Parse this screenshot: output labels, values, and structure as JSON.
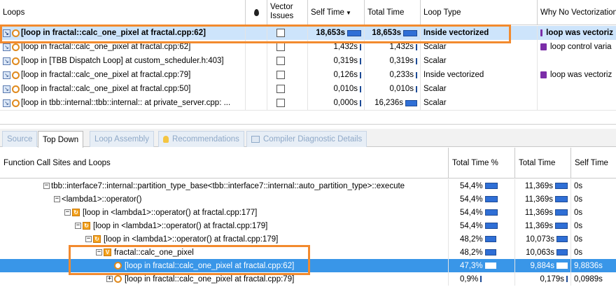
{
  "top_table": {
    "headers": {
      "loops": "Loops",
      "vector_issues": "Vector\nIssues",
      "self_time": "Self Time",
      "total_time": "Total Time",
      "loop_type": "Loop Type",
      "why_no_vec": "Why No Vectorization"
    },
    "rows": [
      {
        "name": "[loop in fractal::calc_one_pixel at fractal.cpp:62]",
        "self": "18,653s",
        "total": "18,653s",
        "type": "Inside vectorized",
        "why": "loop was vectoriz",
        "self_bar": 1.0,
        "total_bar": 1.0,
        "has_why": true
      },
      {
        "name": "[loop in fractal::calc_one_pixel at fractal.cpp:62]",
        "self": "1,432s",
        "total": "1,432s",
        "type": "Scalar",
        "why": "loop control varia",
        "self_bar": 0.08,
        "total_bar": 0.08,
        "has_why": true
      },
      {
        "name": "[loop in [TBB Dispatch Loop] at custom_scheduler.h:403]",
        "self": "0,319s",
        "total": "0,319s",
        "type": "Scalar",
        "why": "",
        "self_bar": 0.02,
        "total_bar": 0.02,
        "has_why": false
      },
      {
        "name": "[loop in fractal::calc_one_pixel at fractal.cpp:79]",
        "self": "0,126s",
        "total": "0,233s",
        "type": "Inside vectorized",
        "why": "loop was vectoriz",
        "self_bar": 0.01,
        "total_bar": 0.01,
        "has_why": true
      },
      {
        "name": "[loop in fractal::calc_one_pixel at fractal.cpp:50]",
        "self": "0,010s",
        "total": "0,010s",
        "type": "Scalar",
        "why": "",
        "self_bar": 0.005,
        "total_bar": 0.005,
        "has_why": false
      },
      {
        "name": "[loop in tbb::internal::tbb::internal:: at private_server.cpp: ...",
        "self": "0,000s",
        "total": "16,236s",
        "type": "Scalar",
        "why": "",
        "self_bar": 0.005,
        "total_bar": 0.87,
        "has_why": false
      }
    ]
  },
  "tabs": [
    "Source",
    "Top Down",
    "Loop Assembly",
    "Recommendations",
    "Compiler Diagnostic Details"
  ],
  "bottom_table": {
    "headers": {
      "sites": "Function Call Sites and Loops",
      "total_pct": "Total Time %",
      "total_time": "Total Time",
      "self_time": "Self Time"
    },
    "rows": [
      {
        "indent": 0,
        "toggle": "−",
        "icon": "none",
        "name": "tbb::interface7::internal::partition_type_base<tbb::interface7::internal::auto_partition_type>::execute",
        "pct": "54,4%",
        "total": "11,369s",
        "self": "0s",
        "pct_bar": 0.544,
        "total_bar": 0.544
      },
      {
        "indent": 1,
        "toggle": "−",
        "icon": "none",
        "name": "<lambda1>::operator()",
        "pct": "54,4%",
        "total": "11,369s",
        "self": "0s",
        "pct_bar": 0.544,
        "total_bar": 0.544
      },
      {
        "indent": 2,
        "toggle": "−",
        "icon": "loop",
        "name": "[loop in <lambda1>::operator() at fractal.cpp:177]",
        "pct": "54,4%",
        "total": "11,369s",
        "self": "0s",
        "pct_bar": 0.544,
        "total_bar": 0.544
      },
      {
        "indent": 3,
        "toggle": "−",
        "icon": "loop",
        "name": "[loop in <lambda1>::operator() at fractal.cpp:179]",
        "pct": "54,4%",
        "total": "11,369s",
        "self": "0s",
        "pct_bar": 0.544,
        "total_bar": 0.544
      },
      {
        "indent": 4,
        "toggle": "−",
        "icon": "loop",
        "name": "[loop in <lambda1>::operator() at fractal.cpp:179]",
        "pct": "48,2%",
        "total": "10,073s",
        "self": "0s",
        "pct_bar": 0.482,
        "total_bar": 0.482
      },
      {
        "indent": 5,
        "toggle": "−",
        "icon": "v",
        "name": "fractal::calc_one_pixel",
        "pct": "48,2%",
        "total": "10,063s",
        "self": "0s",
        "pct_bar": 0.482,
        "total_bar": 0.482
      },
      {
        "indent": 6,
        "toggle": "",
        "icon": "ring",
        "name": "[loop in fractal::calc_one_pixel at fractal.cpp:62]",
        "pct": "47,3%",
        "total": "9,884s",
        "self": "9,8836s",
        "pct_bar": 0.473,
        "total_bar": 0.473
      },
      {
        "indent": 6,
        "toggle": "+",
        "icon": "ring",
        "name": "[loop in fractal::calc_one_pixel at fractal.cpp:79]",
        "pct": "0,9%",
        "total": "0,179s",
        "self": "0,0989s",
        "pct_bar": 0.009,
        "total_bar": 0.009
      }
    ]
  }
}
